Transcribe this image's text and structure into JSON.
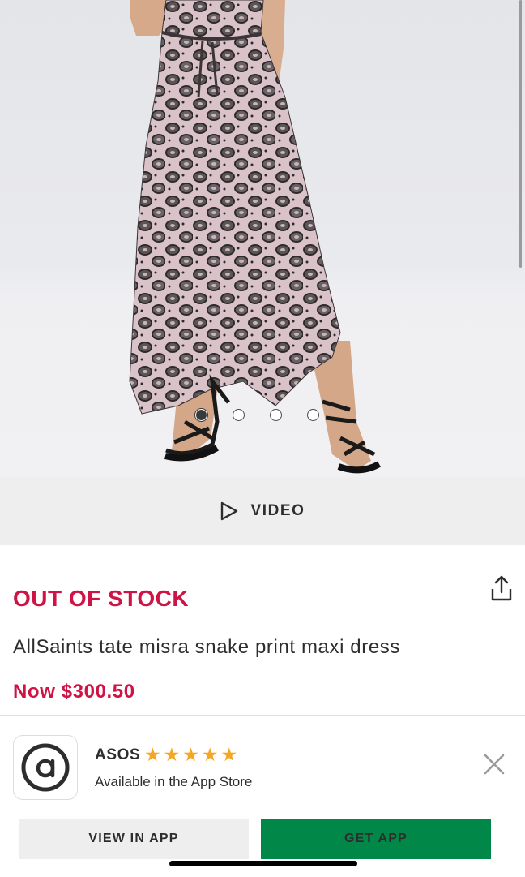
{
  "product_image": {
    "alt": "Model wearing snake print maxi dress",
    "carousel_total": 4,
    "carousel_active_index": 0
  },
  "video": {
    "label": "VIDEO",
    "icon": "play-icon"
  },
  "product": {
    "stock_status": "OUT OF STOCK",
    "name": "AllSaints tate misra snake print maxi dress",
    "price": "Now $300.50",
    "share_icon": "share-icon"
  },
  "app_banner": {
    "app_name": "ASOS",
    "rating_stars": 5,
    "subtitle": "Available in the App Store",
    "view_button": "VIEW IN APP",
    "get_button": "GET APP",
    "close_icon": "close-icon"
  },
  "colors": {
    "accent_red": "#d01345",
    "star_yellow": "#f5a623",
    "get_app_green": "#018849",
    "text_dark": "#2d2d2d"
  }
}
